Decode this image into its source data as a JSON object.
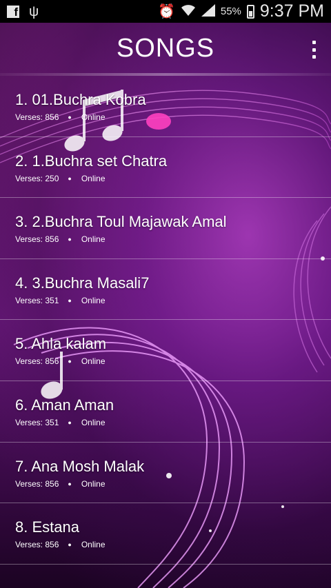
{
  "status_bar": {
    "battery_percent": "55%",
    "time": "9:37 PM",
    "icons": [
      "facebook-icon",
      "usb-icon",
      "alarm-icon",
      "wifi-icon",
      "signal-icon",
      "battery-charging-icon"
    ]
  },
  "app_bar": {
    "title": "SONGS",
    "menu_icon": "overflow-menu-icon"
  },
  "songs": [
    {
      "title": "1. 01.Buchra Kobra",
      "verses": "Verses: 856",
      "status": "Online"
    },
    {
      "title": "2. 1.Buchra set Chatra",
      "verses": "Verses: 250",
      "status": "Online"
    },
    {
      "title": "3. 2.Buchra Toul Majawak Amal",
      "verses": "Verses: 856",
      "status": "Online"
    },
    {
      "title": "4. 3.Buchra Masali7",
      "verses": "Verses: 351",
      "status": "Online"
    },
    {
      "title": "5. Ahla kalam",
      "verses": "Verses: 856",
      "status": "Online"
    },
    {
      "title": "6. Aman Aman",
      "verses": "Verses: 351",
      "status": "Online"
    },
    {
      "title": "7. Ana Mosh Malak",
      "verses": "Verses: 856",
      "status": "Online"
    },
    {
      "title": "8. Estana",
      "verses": "Verses: 856",
      "status": "Online"
    }
  ],
  "colors": {
    "accent_pink": "#e040b0",
    "background_purple": "#5b1470"
  }
}
